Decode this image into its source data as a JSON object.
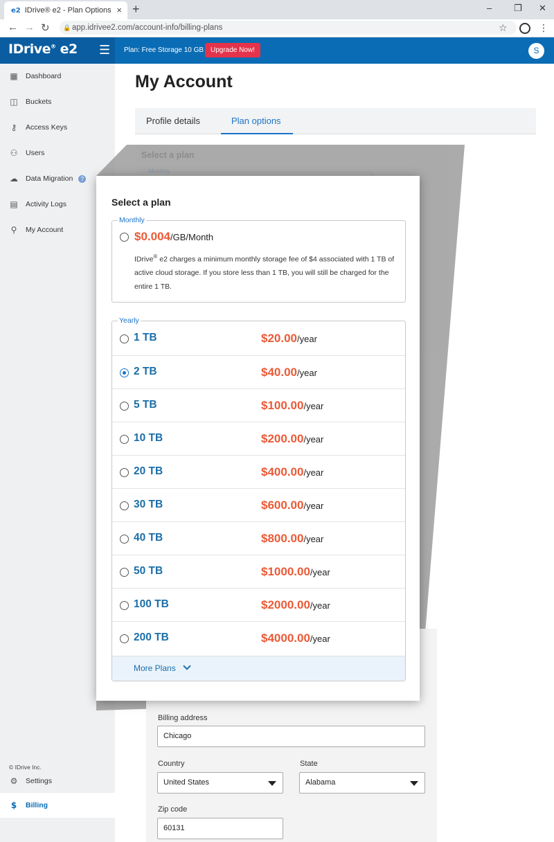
{
  "browser": {
    "tab_title": "IDrive® e2 - Plan Options",
    "tab_favicon": "e2",
    "url": "app.idrivee2.com/account-info/billing-plans"
  },
  "header": {
    "logo_text": "IDrive",
    "logo_suffix": "e2",
    "plan_text": "Plan: Free Storage 10 GB",
    "upgrade_label": "Upgrade Now!",
    "avatar_initial": "S",
    "brand_color": "#0a6cb4",
    "upgrade_color": "#e5334b"
  },
  "sidebar": {
    "items": [
      {
        "label": "Dashboard",
        "icon": "dashboard-icon"
      },
      {
        "label": "Buckets",
        "icon": "bucket-icon"
      },
      {
        "label": "Access Keys",
        "icon": "key-icon"
      },
      {
        "label": "Users",
        "icon": "users-icon"
      },
      {
        "label": "Data Migration",
        "icon": "cloud-icon"
      },
      {
        "label": "Activity Logs",
        "icon": "document-icon"
      },
      {
        "label": "My Account",
        "icon": "user-icon"
      }
    ],
    "bottom_items": [
      {
        "label": "Settings",
        "icon": "gear-icon"
      },
      {
        "label": "Billing",
        "icon": "dollar-icon"
      }
    ],
    "copyright": "© IDrive Inc."
  },
  "main": {
    "title": "My Account",
    "tabs": [
      {
        "label": "Profile details"
      },
      {
        "label": "Plan options"
      }
    ],
    "bg_select_plan": "Select a plan",
    "bg_monthly": "Monthly"
  },
  "modal": {
    "title": "Select a plan",
    "monthly_legend": "Monthly",
    "monthly_price": "$0.004",
    "monthly_unit": "/GB/Month",
    "desc_pre": "IDrive",
    "desc_sup": "®",
    "desc_post": " e2 charges a minimum monthly storage fee of $4 associated with 1 TB of active cloud storage. If you store less than 1 TB, you will still be charged for the entire 1 TB.",
    "yearly_legend": "Yearly",
    "yearly_unit": "/year",
    "plans": [
      {
        "size": "1 TB",
        "price": "$20.00"
      },
      {
        "size": "2 TB",
        "price": "$40.00"
      },
      {
        "size": "5 TB",
        "price": "$100.00"
      },
      {
        "size": "10 TB",
        "price": "$200.00"
      },
      {
        "size": "20 TB",
        "price": "$400.00"
      },
      {
        "size": "30 TB",
        "price": "$600.00"
      },
      {
        "size": "40 TB",
        "price": "$800.00"
      },
      {
        "size": "50 TB",
        "price": "$1000.00"
      },
      {
        "size": "100 TB",
        "price": "$2000.00"
      },
      {
        "size": "200 TB",
        "price": "$4000.00"
      }
    ],
    "more_plans": "More Plans",
    "price_color": "#ea5a37"
  },
  "billing": {
    "address_label": "Billing address",
    "address_value": "Chicago",
    "country_label": "Country",
    "country_value": "United States",
    "state_label": "State",
    "state_value": "Alabama",
    "zip_label": "Zip code",
    "zip_value": "60131"
  }
}
